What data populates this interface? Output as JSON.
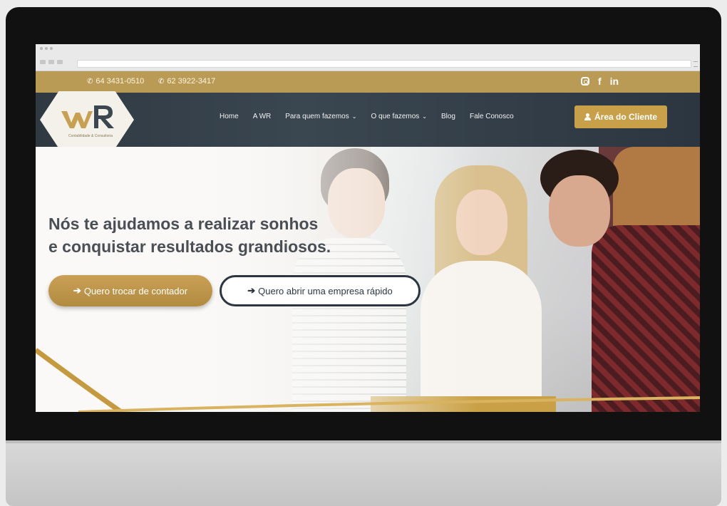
{
  "topbar": {
    "phone1": "64 3431-0510",
    "phone2": "62 3922-3417",
    "social": [
      "instagram-icon",
      "facebook-icon",
      "linkedin-icon"
    ],
    "facebook_glyph": "f",
    "linkedin_glyph": "in"
  },
  "navbar": {
    "items": [
      {
        "label": "Home",
        "dropdown": false
      },
      {
        "label": "A WR",
        "dropdown": false
      },
      {
        "label": "Para quem fazemos",
        "dropdown": true
      },
      {
        "label": "O que fazemos",
        "dropdown": true
      },
      {
        "label": "Blog",
        "dropdown": false
      },
      {
        "label": "Fale Conosco",
        "dropdown": false
      }
    ],
    "client_button": "Área do Cliente",
    "chevron": "⌄"
  },
  "hero": {
    "title_line1": "Nós te ajudamos a realizar sonhos",
    "title_line2": "e conquistar resultados grandiosos.",
    "button_primary": "Quero trocar de contador",
    "button_secondary": "Quero abrir uma empresa rápido",
    "arrow": "➔"
  },
  "colors": {
    "gold": "#b99b55",
    "navy": "#2f3942",
    "button_gold": "#c9a04a"
  }
}
